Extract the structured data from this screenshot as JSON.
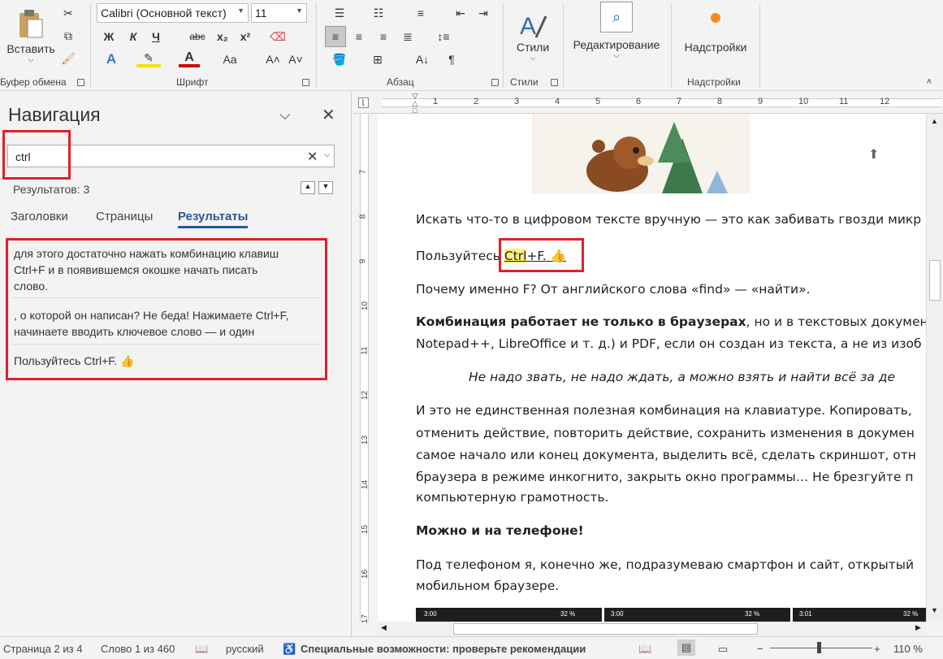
{
  "ribbon": {
    "clipboard": {
      "paste_label": "Вставить",
      "group_label": "Буфер обмена"
    },
    "font": {
      "name": "Calibri (Основной текст)",
      "size": "11",
      "group_label": "Шрифт",
      "bold": "Ж",
      "italic": "К",
      "underline": "Ч",
      "strike": "abc",
      "sub": "x₂",
      "sup": "x²",
      "case": "Aa"
    },
    "paragraph": {
      "group_label": "Абзац"
    },
    "styles": {
      "label": "Стили",
      "group_label": "Стили"
    },
    "editing": {
      "label": "Редактирование"
    },
    "addins": {
      "label": "Надстройки",
      "group_label": "Надстройки"
    }
  },
  "nav": {
    "title": "Навигация",
    "search_value": "ctrl",
    "results_count": "Результатов: 3",
    "tabs": [
      "Заголовки",
      "Страницы",
      "Результаты"
    ],
    "results": [
      {
        "lines": [
          "для этого достаточно нажать комбинацию клавиш",
          "Ctrl+F и в появившемся окошке начать писать",
          "слово."
        ]
      },
      {
        "lines": [
          ", о которой он написан? Не беда! Нажимаете Ctrl+F,",
          "начинаете вводить ключевое слово — и один"
        ]
      },
      {
        "lines": [
          "Пользуйтесь Ctrl+F. 👍"
        ]
      }
    ]
  },
  "ruler_h": [
    "1",
    "2",
    "3",
    "4",
    "5",
    "6",
    "7",
    "8",
    "9",
    "10",
    "11",
    "12"
  ],
  "ruler_v": [
    "7",
    "8",
    "9",
    "10",
    "11",
    "12",
    "13",
    "14",
    "15",
    "16",
    "17"
  ],
  "doc": {
    "p1": "Искать что-то в цифровом тексте вручную — это как забивать гвозди микр",
    "p2_pre": "Пользуйтесь ",
    "p2_hl": "Ctrl",
    "p2_post": "+F. 👍",
    "p3": "Почему именно F? От английского слова «find» — «найти».",
    "p4_bold": "Комбинация работает не только в браузерах",
    "p4_rest": ", но и в текстовых документ",
    "p4b": "Notepad++, LibreOffice и т. д.) и PDF, если он создан из текста, а не из изоб",
    "p5": "Не надо звать, не надо ждать, а можно взять и найти всё за де",
    "p6": "И это не единственная полезная комбинация на клавиатуре. Копировать,",
    "p6b": "отменить действие, повторить действие, сохранить изменения в докумен",
    "p6c": "самое начало или конец документа, выделить всё, сделать скриншот, отн",
    "p6d": "браузера в режиме инкогнито, закрыть окно программы… Не брезгуйте п",
    "p6e": "компьютерную грамотность.",
    "h1": "Можно и на телефоне!",
    "p7": "Под телефоном я, конечно же, подразумеваю смартфон и сайт, открытый",
    "p7b": "мобильном браузере.",
    "phone_times": [
      "3:00",
      "3:00",
      "3:01"
    ],
    "phone_battery": [
      "32 %",
      "32 %",
      "32 %"
    ]
  },
  "status": {
    "page": "Страница 2 из 4",
    "words": "Слово 1 из 460",
    "lang": "русский",
    "accessibility": "Специальные возможности: проверьте рекомендации",
    "zoom": "110 %"
  },
  "colors": {
    "highlight_red": "#e0202a",
    "tab_active": "#2b579a",
    "text_highlight": "#fff17a"
  }
}
